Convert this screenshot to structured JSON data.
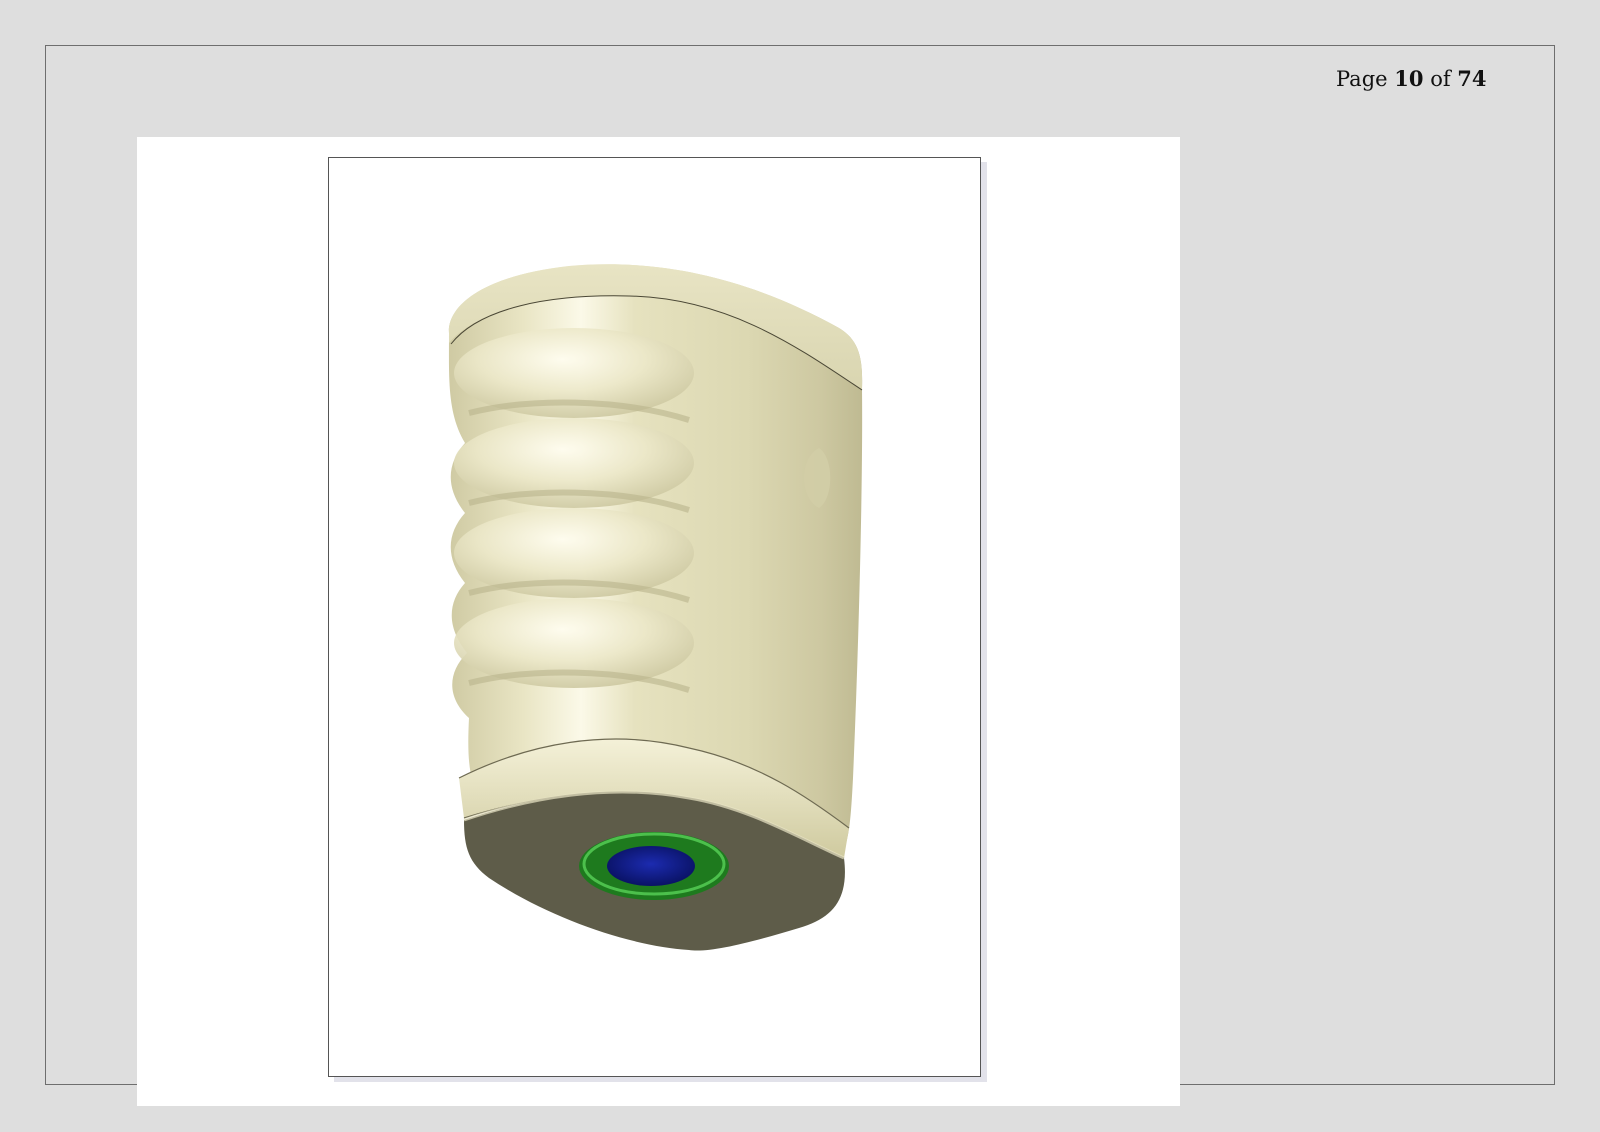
{
  "page": {
    "label_prefix": "Page",
    "current": "10",
    "label_of": "of",
    "total": "74"
  },
  "figure": {
    "subject": "device-housing-3d-render",
    "colors": {
      "body": "#e6e2bf",
      "body_shadow": "#b8b38c",
      "bottom_face": "#5d5b48",
      "ring": "#1e7a1e",
      "ring_highlight": "#3fae3f",
      "port": "#0f1a8a"
    }
  }
}
